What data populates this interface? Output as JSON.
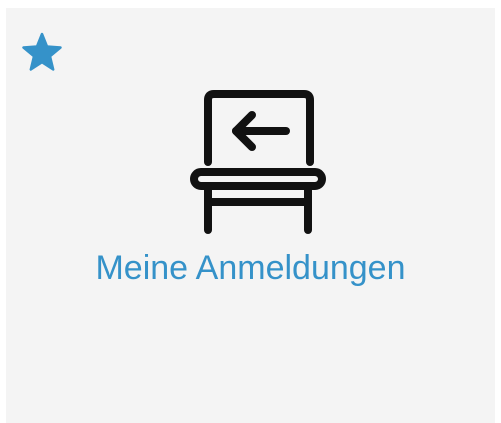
{
  "tile": {
    "label": "Meine Anmeldungen",
    "favorite_icon": "star-icon",
    "main_icon": "lectern-arrow-left-icon"
  },
  "colors": {
    "accent": "#3592c9",
    "tile_background": "#f4f4f4",
    "icon": "#111111"
  }
}
